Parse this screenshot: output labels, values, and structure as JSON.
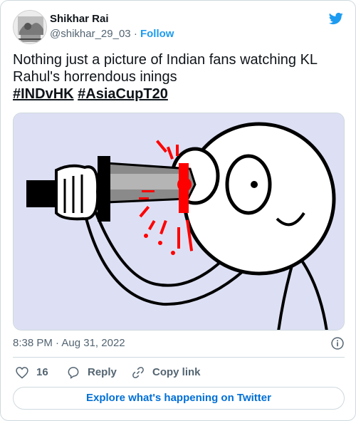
{
  "author": {
    "name": "Shikhar Rai",
    "handle": "@shikhar_29_03",
    "separator": "·",
    "follow_label": "Follow"
  },
  "tweet": {
    "text_line": "Nothing just a picture of Indian fans watching KL Rahul's horrendous inings",
    "hashtags": [
      "#INDvHK",
      "#AsiaCupT20"
    ]
  },
  "meta": {
    "time": "8:38 PM",
    "separator": "·",
    "date": "Aug 31, 2022"
  },
  "actions": {
    "like_count": "16",
    "reply_label": "Reply",
    "copy_label": "Copy link"
  },
  "explore_label": "Explore what's happening on Twitter",
  "colors": {
    "twitter_blue": "#1d9bf0",
    "link_blue": "#006fd6",
    "text": "#0f1419",
    "secondary": "#536471",
    "media_bg": "#dde0f4",
    "blood": "#ff0000"
  },
  "icons": [
    "twitter-bird-icon",
    "info-icon",
    "heart-icon",
    "reply-icon",
    "link-icon"
  ]
}
